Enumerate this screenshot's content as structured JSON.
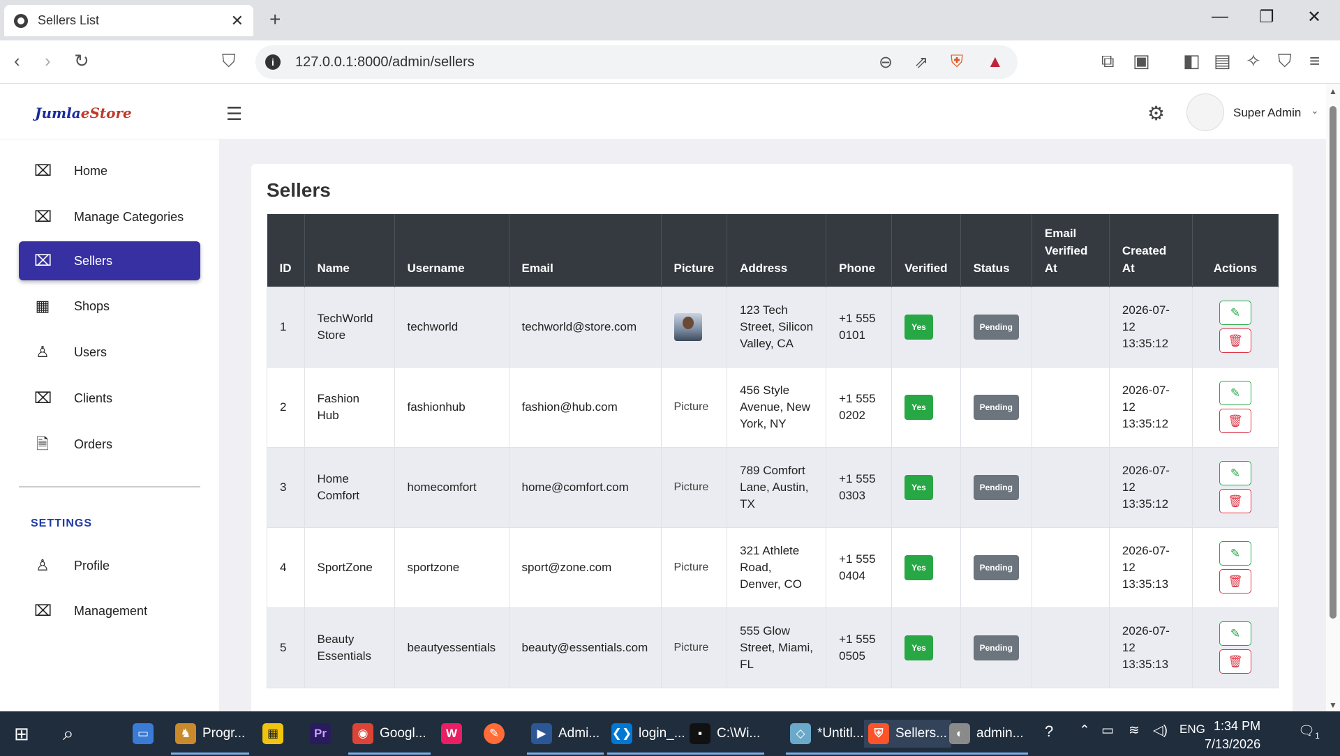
{
  "browser": {
    "tab_title": "Sellers List",
    "url": "127.0.0.1:8000/admin/sellers"
  },
  "app": {
    "logo_part1": "Jumla",
    "logo_part2": "eStore",
    "user_name": "Super Admin"
  },
  "sidebar": {
    "items": [
      {
        "label": "Home",
        "icon": "x-box-icon"
      },
      {
        "label": "Manage Categories",
        "icon": "x-box-icon"
      },
      {
        "label": "Sellers",
        "icon": "x-box-icon",
        "active": true
      },
      {
        "label": "Shops",
        "icon": "building-icon"
      },
      {
        "label": "Users",
        "icon": "user-icon"
      },
      {
        "label": "Clients",
        "icon": "x-box-icon"
      },
      {
        "label": "Orders",
        "icon": "document-icon"
      }
    ],
    "settings_heading": "SETTINGS",
    "settings_items": [
      {
        "label": "Profile",
        "icon": "user-icon"
      },
      {
        "label": "Management",
        "icon": "x-box-icon"
      }
    ]
  },
  "main": {
    "title": "Sellers",
    "columns": [
      "ID",
      "Name",
      "Username",
      "Email",
      "Picture",
      "Address",
      "Phone",
      "Verified",
      "Status",
      "Email Verified At",
      "Created At",
      "Actions"
    ],
    "rows": [
      {
        "id": "1",
        "name": "TechWorld Store",
        "username": "techworld",
        "email": "techworld@store.com",
        "picture": "",
        "address": "123 Tech Street, Silicon Valley, CA",
        "phone": "+1 555 0101",
        "verified": "Yes",
        "status": "Pending",
        "email_verified_at": "",
        "created_at": "2026-07-12 13:35:12"
      },
      {
        "id": "2",
        "name": "Fashion Hub",
        "username": "fashionhub",
        "email": "fashion@hub.com",
        "picture": "Picture",
        "address": "456 Style Avenue, New York, NY",
        "phone": "+1 555 0202",
        "verified": "Yes",
        "status": "Pending",
        "email_verified_at": "",
        "created_at": "2026-07-12 13:35:12"
      },
      {
        "id": "3",
        "name": "Home Comfort",
        "username": "homecomfort",
        "email": "home@comfort.com",
        "picture": "Picture",
        "address": "789 Comfort Lane, Austin, TX",
        "phone": "+1 555 0303",
        "verified": "Yes",
        "status": "Pending",
        "email_verified_at": "",
        "created_at": "2026-07-12 13:35:12"
      },
      {
        "id": "4",
        "name": "SportZone",
        "username": "sportzone",
        "email": "sport@zone.com",
        "picture": "Picture",
        "address": "321 Athlete Road, Denver, CO",
        "phone": "+1 555 0404",
        "verified": "Yes",
        "status": "Pending",
        "email_verified_at": "",
        "created_at": "2026-07-12 13:35:13"
      },
      {
        "id": "5",
        "name": "Beauty Essentials",
        "username": "beautyessentials",
        "email": "beauty@essentials.com",
        "picture": "Picture",
        "address": "555 Glow Street, Miami, FL",
        "phone": "+1 555 0505",
        "verified": "Yes",
        "status": "Pending",
        "email_verified_at": "",
        "created_at": "2026-07-12 13:35:13"
      }
    ]
  },
  "taskbar": {
    "apps": [
      {
        "label": "Progr...",
        "color": "#c98a2b"
      },
      {
        "label": "Googl...",
        "color": "#db4437"
      },
      {
        "label": "Admi...",
        "color": "#2b5797"
      },
      {
        "label": "login_...",
        "color": "#0078d4"
      },
      {
        "label": "C:\\Wi...",
        "color": "#111111"
      },
      {
        "label": "*Untitl...",
        "color": "#6aa9c9"
      },
      {
        "label": "Sellers...",
        "color": "#fb542b",
        "active": true
      },
      {
        "label": "admin...",
        "color": "#8a8a8a"
      }
    ],
    "lang": "ENG",
    "time": "1:34 PM",
    "date": "7/13/2026",
    "notification_count": "1"
  }
}
